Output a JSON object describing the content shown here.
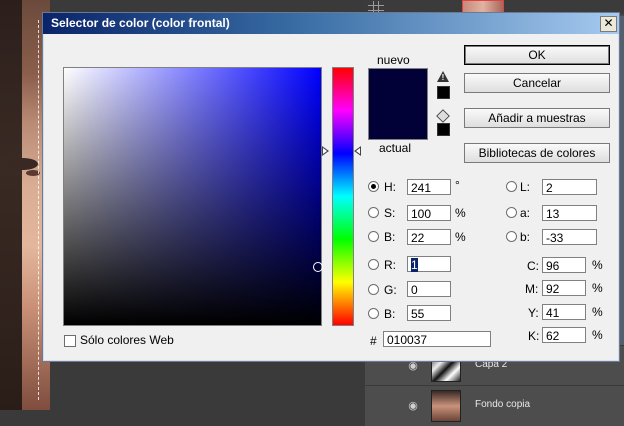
{
  "background": {
    "layers": [
      {
        "name": "Capa 2"
      },
      {
        "name": "Fondo copia"
      }
    ]
  },
  "dialog": {
    "title": "Selector de color (color frontal)",
    "close_label": "✕",
    "swatch": {
      "new_label": "nuevo",
      "current_label": "actual",
      "new_color": "#010037",
      "current_color": "#010037"
    },
    "buttons": {
      "ok": "OK",
      "cancel": "Cancelar",
      "add_swatches": "Añadir a muestras",
      "libraries": "Bibliotecas de colores"
    },
    "hsb": {
      "h": {
        "label": "H:",
        "value": "241",
        "unit": "°",
        "selected": true
      },
      "s": {
        "label": "S:",
        "value": "100",
        "unit": "%"
      },
      "b": {
        "label": "B:",
        "value": "22",
        "unit": "%"
      }
    },
    "rgb": {
      "r": {
        "label": "R:",
        "value": "1"
      },
      "g": {
        "label": "G:",
        "value": "0"
      },
      "b": {
        "label": "B:",
        "value": "55"
      }
    },
    "lab": {
      "l": {
        "label": "L:",
        "value": "2"
      },
      "a": {
        "label": "a:",
        "value": "13"
      },
      "b": {
        "label": "b:",
        "value": "-33"
      }
    },
    "cmyk": {
      "c": {
        "label": "C:",
        "value": "96",
        "unit": "%"
      },
      "m": {
        "label": "M:",
        "value": "92",
        "unit": "%"
      },
      "y": {
        "label": "Y:",
        "value": "41",
        "unit": "%"
      },
      "k": {
        "label": "K:",
        "value": "62",
        "unit": "%"
      }
    },
    "hex": {
      "label": "#",
      "value": "010037"
    },
    "web_only": {
      "label": "Sólo colores Web",
      "checked": false
    }
  }
}
